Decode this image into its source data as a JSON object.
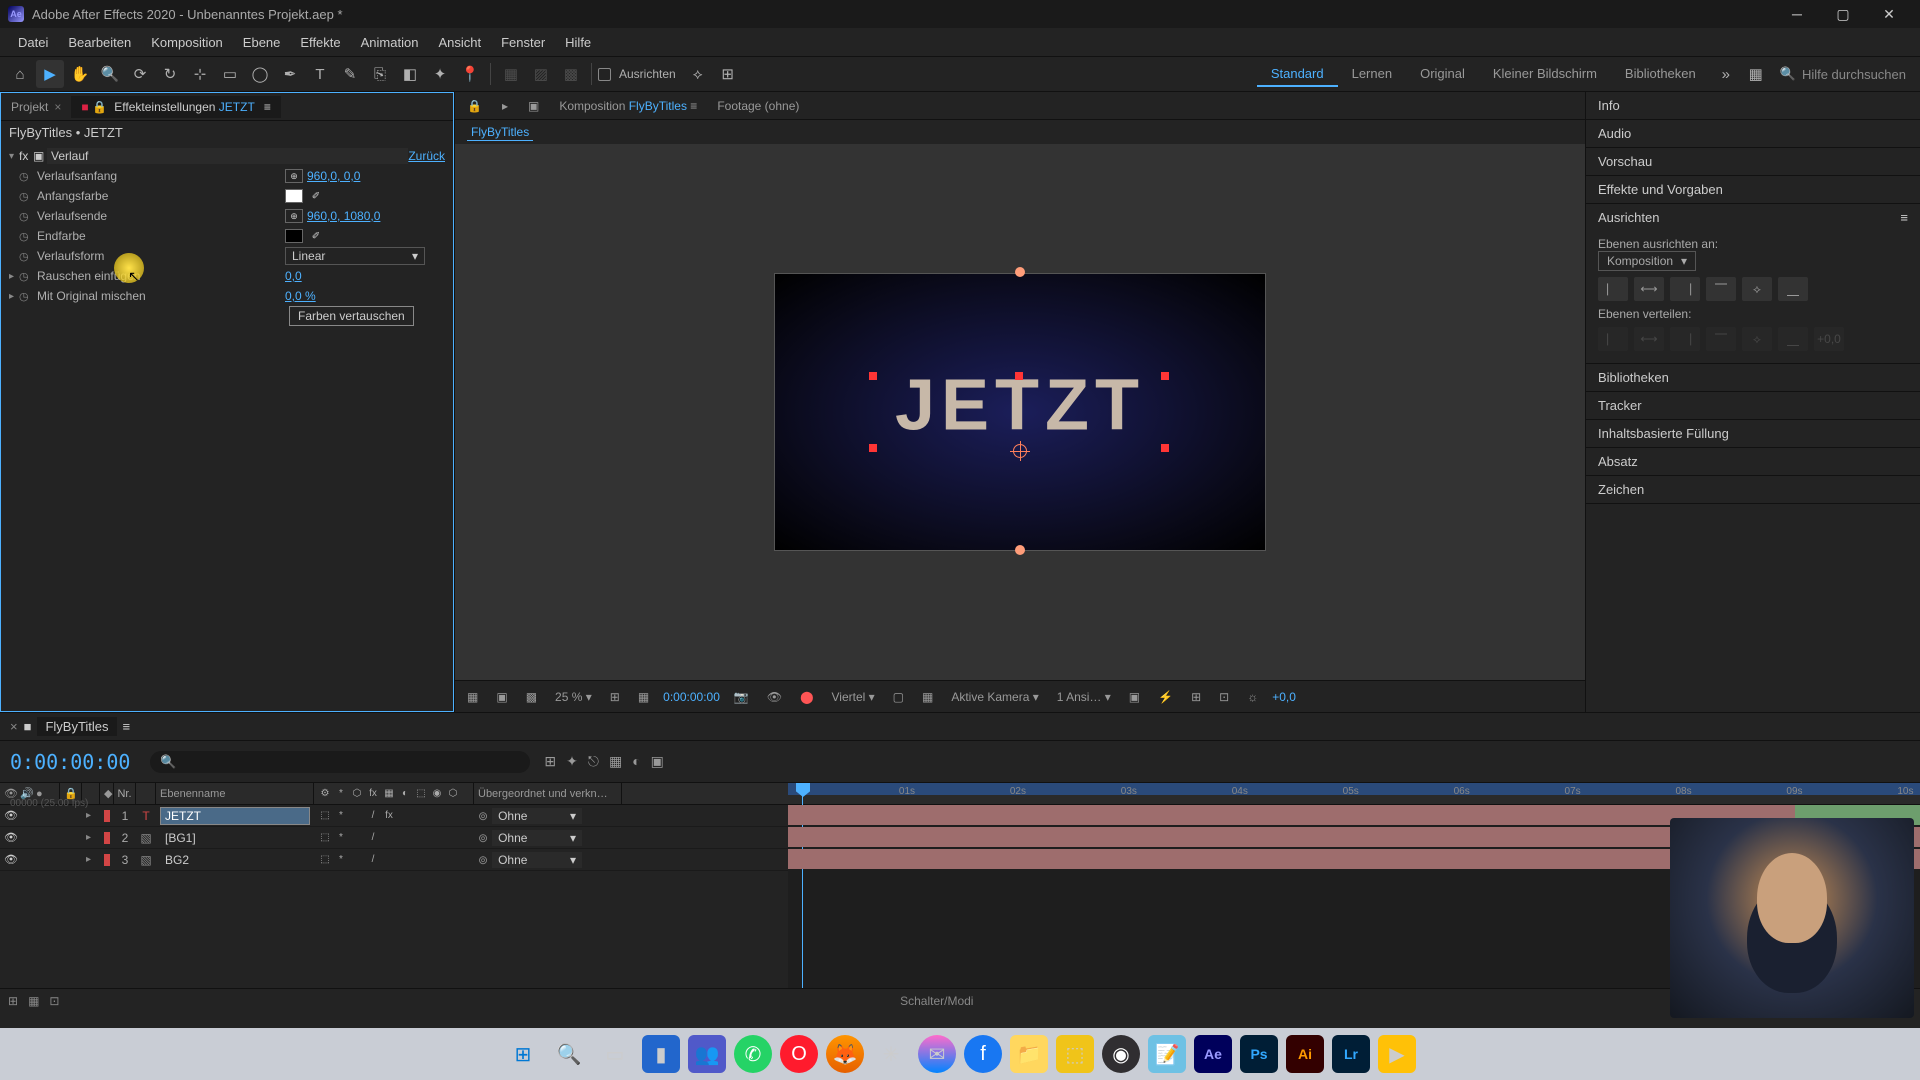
{
  "titlebar": {
    "title": "Adobe After Effects 2020 - Unbenanntes Projekt.aep *"
  },
  "menu": [
    "Datei",
    "Bearbeiten",
    "Komposition",
    "Ebene",
    "Effekte",
    "Animation",
    "Ansicht",
    "Fenster",
    "Hilfe"
  ],
  "toolbar": {
    "snapping_label": "Ausrichten",
    "workspaces": [
      "Standard",
      "Lernen",
      "Original",
      "Kleiner Bildschirm",
      "Bibliotheken"
    ],
    "active_ws": 0,
    "search_placeholder": "Hilfe durchsuchen"
  },
  "left": {
    "tab_project": "Projekt",
    "tab_fx": "Effekteinstellungen",
    "fx_target": "JETZT",
    "breadcrumb": "FlyByTitles • JETZT",
    "fx_name": "Verlauf",
    "reset": "Zurück",
    "props": {
      "p1": "Verlaufsanfang",
      "v1": "960,0, 0,0",
      "p2": "Anfangsfarbe",
      "p3": "Verlaufsende",
      "v3": "960,0, 1080,0",
      "p4": "Endfarbe",
      "p5": "Verlaufsform",
      "v5": "Linear",
      "p6": "Rauschen einfügen",
      "v6": "0,0",
      "p7": "Mit Original mischen",
      "v7": "0,0 %"
    },
    "swap": "Farben vertauschen",
    "swatch1": "#ffffff",
    "swatch2": "#000000"
  },
  "center": {
    "tab_comp_prefix": "Komposition",
    "tab_comp_link": "FlyByTitles",
    "tab_footage": "Footage  (ohne)",
    "crumb": "FlyByTitles",
    "text": "JETZT",
    "zoom": "25 %",
    "timecode": "0:00:00:00",
    "res": "Viertel",
    "camera": "Aktive Kamera",
    "views": "1 Ansi…",
    "exposure": "+0,0"
  },
  "right": {
    "panels": [
      "Info",
      "Audio",
      "Vorschau",
      "Effekte und Vorgaben"
    ],
    "align_title": "Ausrichten",
    "align_label": "Ebenen ausrichten an:",
    "align_target": "Komposition",
    "dist_label": "Ebenen verteilen:",
    "panels2": [
      "Bibliotheken",
      "Tracker",
      "Inhaltsbasierte Füllung",
      "Absatz",
      "Zeichen"
    ]
  },
  "timeline": {
    "tab": "FlyByTitles",
    "tc": "0:00:00:00",
    "fps": "00000 (25.00 fps)",
    "col_nr": "Nr.",
    "col_name": "Ebenenname",
    "col_parent": "Übergeordnet und verkn…",
    "layers": [
      {
        "nr": "1",
        "name": "JETZT",
        "color": "#d24545",
        "type": "T",
        "parent": "Ohne",
        "selected": true,
        "bracket": false
      },
      {
        "nr": "2",
        "name": "[BG1]",
        "color": "#d24545",
        "type": "▧",
        "parent": "Ohne",
        "selected": false,
        "bracket": false
      },
      {
        "nr": "3",
        "name": "BG2",
        "color": "#d24545",
        "type": "▧",
        "parent": "Ohne",
        "selected": false,
        "bracket": false
      }
    ],
    "ticks": [
      "01s",
      "02s",
      "03s",
      "04s",
      "05s",
      "06s",
      "07s",
      "08s",
      "09s",
      "10s"
    ],
    "footer": "Schalter/Modi"
  },
  "taskbar_icons": [
    "win",
    "search",
    "tasks",
    "explorer",
    "teams",
    "whatsapp",
    "opera",
    "firefox",
    "app1",
    "messenger",
    "facebook",
    "files",
    "app2",
    "obs",
    "notepad",
    "ae",
    "ps",
    "ai",
    "lr",
    "app3"
  ]
}
